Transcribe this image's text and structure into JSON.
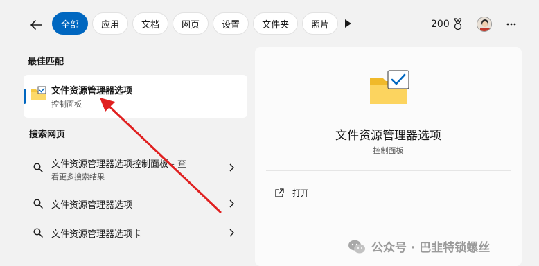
{
  "filters": {
    "items": [
      "全部",
      "应用",
      "文档",
      "网页",
      "设置",
      "文件夹",
      "照片"
    ],
    "active_index": 0
  },
  "header": {
    "points": "200"
  },
  "best_match": {
    "section_title": "最佳匹配",
    "title": "文件资源管理器选项",
    "subtitle": "控制面板"
  },
  "web_search": {
    "section_title": "搜索网页",
    "items": [
      {
        "text": "文件资源管理器选项控制面板",
        "suffix": " - 查",
        "subtitle": "看更多搜索结果"
      },
      {
        "text": "文件资源管理器选项"
      },
      {
        "text": "文件资源管理器选项卡"
      }
    ]
  },
  "preview": {
    "title": "文件资源管理器选项",
    "subtitle": "控制面板",
    "open_label": "打开"
  },
  "watermark": {
    "text": "公众号 · 巴韭特锁螺丝"
  },
  "colors": {
    "accent": "#0067c0",
    "arrow": "#e02020",
    "folder": "#f5c842"
  }
}
